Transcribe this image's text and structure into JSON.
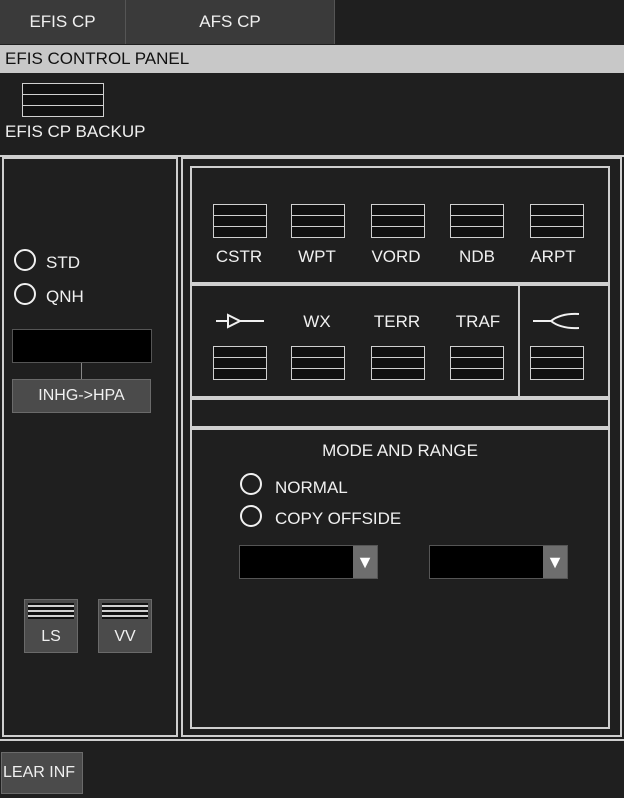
{
  "tabs": {
    "efis_cp": "EFIS CP",
    "afs_cp": "AFS CP"
  },
  "panel_title": "EFIS CONTROL PANEL",
  "backup_label": "EFIS CP BACKUP",
  "baro": {
    "std_label": "STD",
    "qnh_label": "QNH",
    "value": "",
    "convert_label": "INHG->HPA"
  },
  "nav_buttons": [
    "CSTR",
    "WPT",
    "VORD",
    "NDB",
    "ARPT"
  ],
  "overlay_buttons": [
    "WX",
    "TERR",
    "TRAF"
  ],
  "bottom_buttons": {
    "ls": "LS",
    "vv": "VV"
  },
  "mode_range": {
    "title": "MODE AND RANGE",
    "normal_label": "NORMAL",
    "copy_label": "COPY OFFSIDE",
    "mode_value": "",
    "range_value": ""
  },
  "footer_button": "LEAR INF",
  "icons": {
    "dropdown_arrow": "▼"
  }
}
